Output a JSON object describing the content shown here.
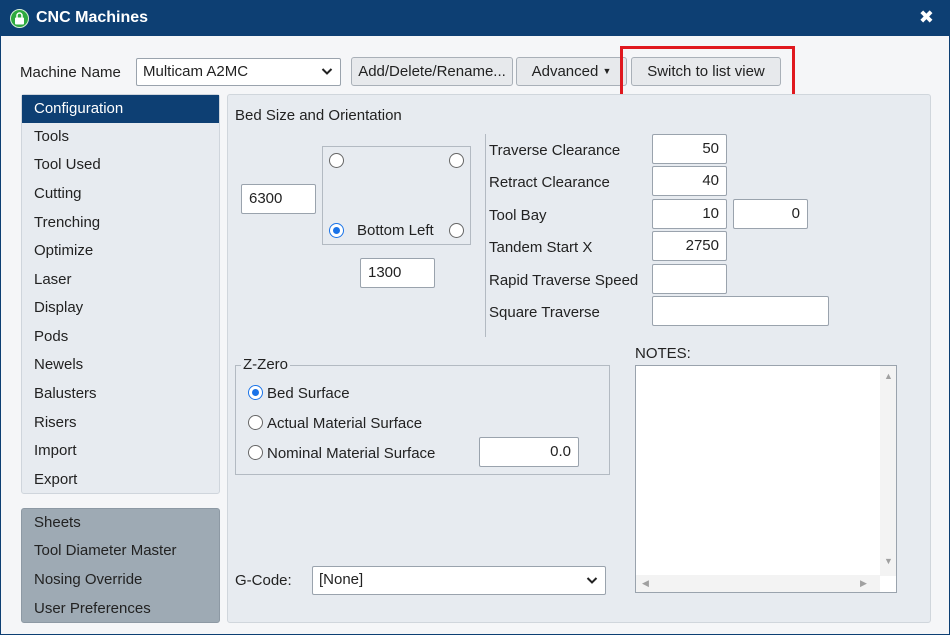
{
  "window": {
    "title": "CNC Machines",
    "close": "✖"
  },
  "header": {
    "machine_name_label": "Machine Name",
    "machine_name_value": "Multicam A2MC",
    "add_delete_rename": "Add/Delete/Rename...",
    "advanced": "Advanced",
    "switch_view": "Switch to list view"
  },
  "sidebar": {
    "items": [
      {
        "label": "Configuration",
        "active": true
      },
      {
        "label": "Tools"
      },
      {
        "label": "Tool Used"
      },
      {
        "label": "Cutting"
      },
      {
        "label": "Trenching"
      },
      {
        "label": "Optimize"
      },
      {
        "label": "Laser"
      },
      {
        "label": "Display"
      },
      {
        "label": "Pods"
      },
      {
        "label": "Newels"
      },
      {
        "label": "Balusters"
      },
      {
        "label": "Risers"
      },
      {
        "label": "Import"
      },
      {
        "label": "Export"
      }
    ],
    "secondary_items": [
      {
        "label": "Sheets"
      },
      {
        "label": "Tool Diameter Master"
      },
      {
        "label": "Nosing Override"
      },
      {
        "label": "User Preferences"
      }
    ]
  },
  "bed": {
    "title": "Bed Size and Orientation",
    "length": "6300",
    "width": "1300",
    "selected_orientation": "Bottom Left"
  },
  "params": {
    "traverse_clearance_label": "Traverse Clearance",
    "traverse_clearance": "50",
    "retract_clearance_label": "Retract Clearance",
    "retract_clearance": "40",
    "tool_bay_label": "Tool Bay",
    "tool_bay_1": "10",
    "tool_bay_2": "0",
    "tandem_start_x_label": "Tandem Start X",
    "tandem_start_x": "2750",
    "rapid_traverse_speed_label": "Rapid Traverse Speed",
    "rapid_traverse_speed": "",
    "square_traverse_label": "Square Traverse",
    "square_traverse": ""
  },
  "zzero": {
    "title": "Z-Zero",
    "options": [
      {
        "label": "Bed Surface",
        "selected": true
      },
      {
        "label": "Actual Material Surface"
      },
      {
        "label": "Nominal Material Surface"
      }
    ],
    "nominal_value": "0.0"
  },
  "notes": {
    "label": "NOTES:",
    "value": ""
  },
  "gcode": {
    "label": "G-Code:",
    "value": "[None]"
  },
  "colors": {
    "titlebar": "#0d3f73",
    "accent": "#1a73e8",
    "highlight": "#e0181f",
    "active_item": "#0d3f73"
  }
}
